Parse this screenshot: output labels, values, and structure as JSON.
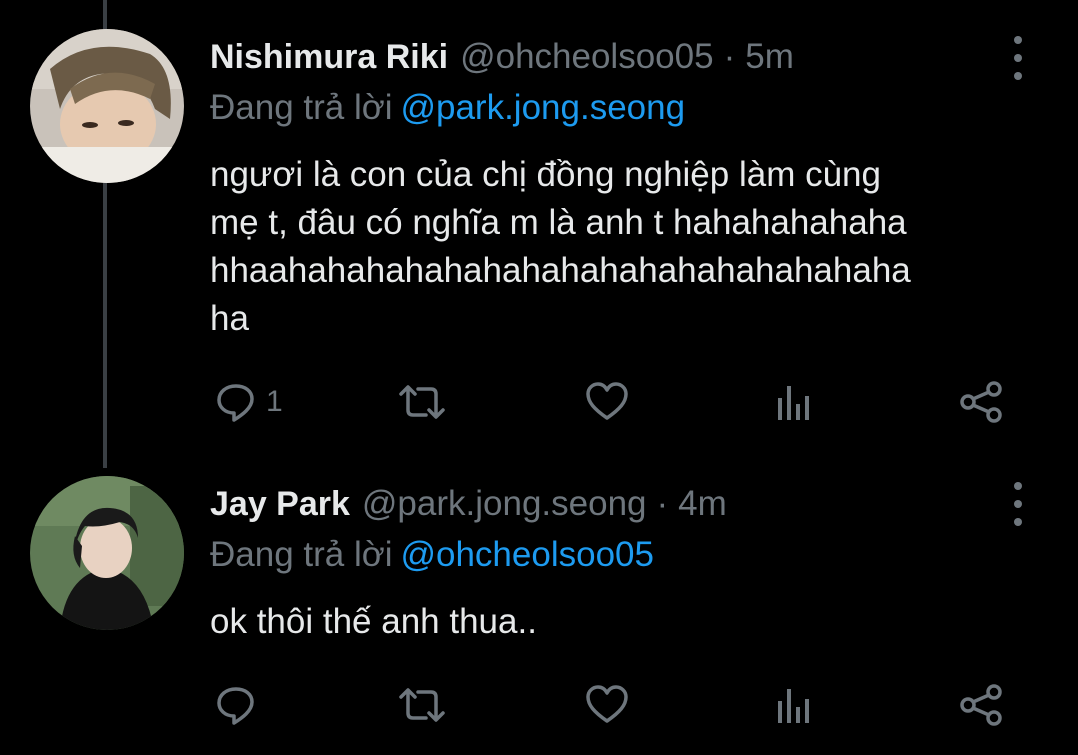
{
  "tweets": [
    {
      "name": "Nishimura Riki",
      "handle": "@ohcheolsoo05",
      "separator": "·",
      "time": "5m",
      "reply_prefix": "Đang trả lời",
      "reply_to": "@park.jong.seong",
      "text": "ngươi là con của chị đồng nghiệp làm cùng\nmẹ t, đâu có nghĩa m là anh t hahahahahaha\nhhaahahahahahahahahahahahahahahahaha\nha",
      "reply_count": "1"
    },
    {
      "name": "Jay Park",
      "handle": "@park.jong.seong",
      "separator": "·",
      "time": "4m",
      "reply_prefix": "Đang trả lời",
      "reply_to": "@ohcheolsoo05",
      "text": "ok thôi thế anh thua..",
      "reply_count": ""
    }
  ],
  "icons": [
    "reply-icon",
    "retweet-icon",
    "like-icon",
    "views-icon",
    "share-icon",
    "more-icon"
  ],
  "colors": {
    "background": "#000000",
    "text": "#e7e9ea",
    "muted": "#6e767d",
    "link": "#1d9bf0",
    "thread_line": "#3a3f44"
  }
}
